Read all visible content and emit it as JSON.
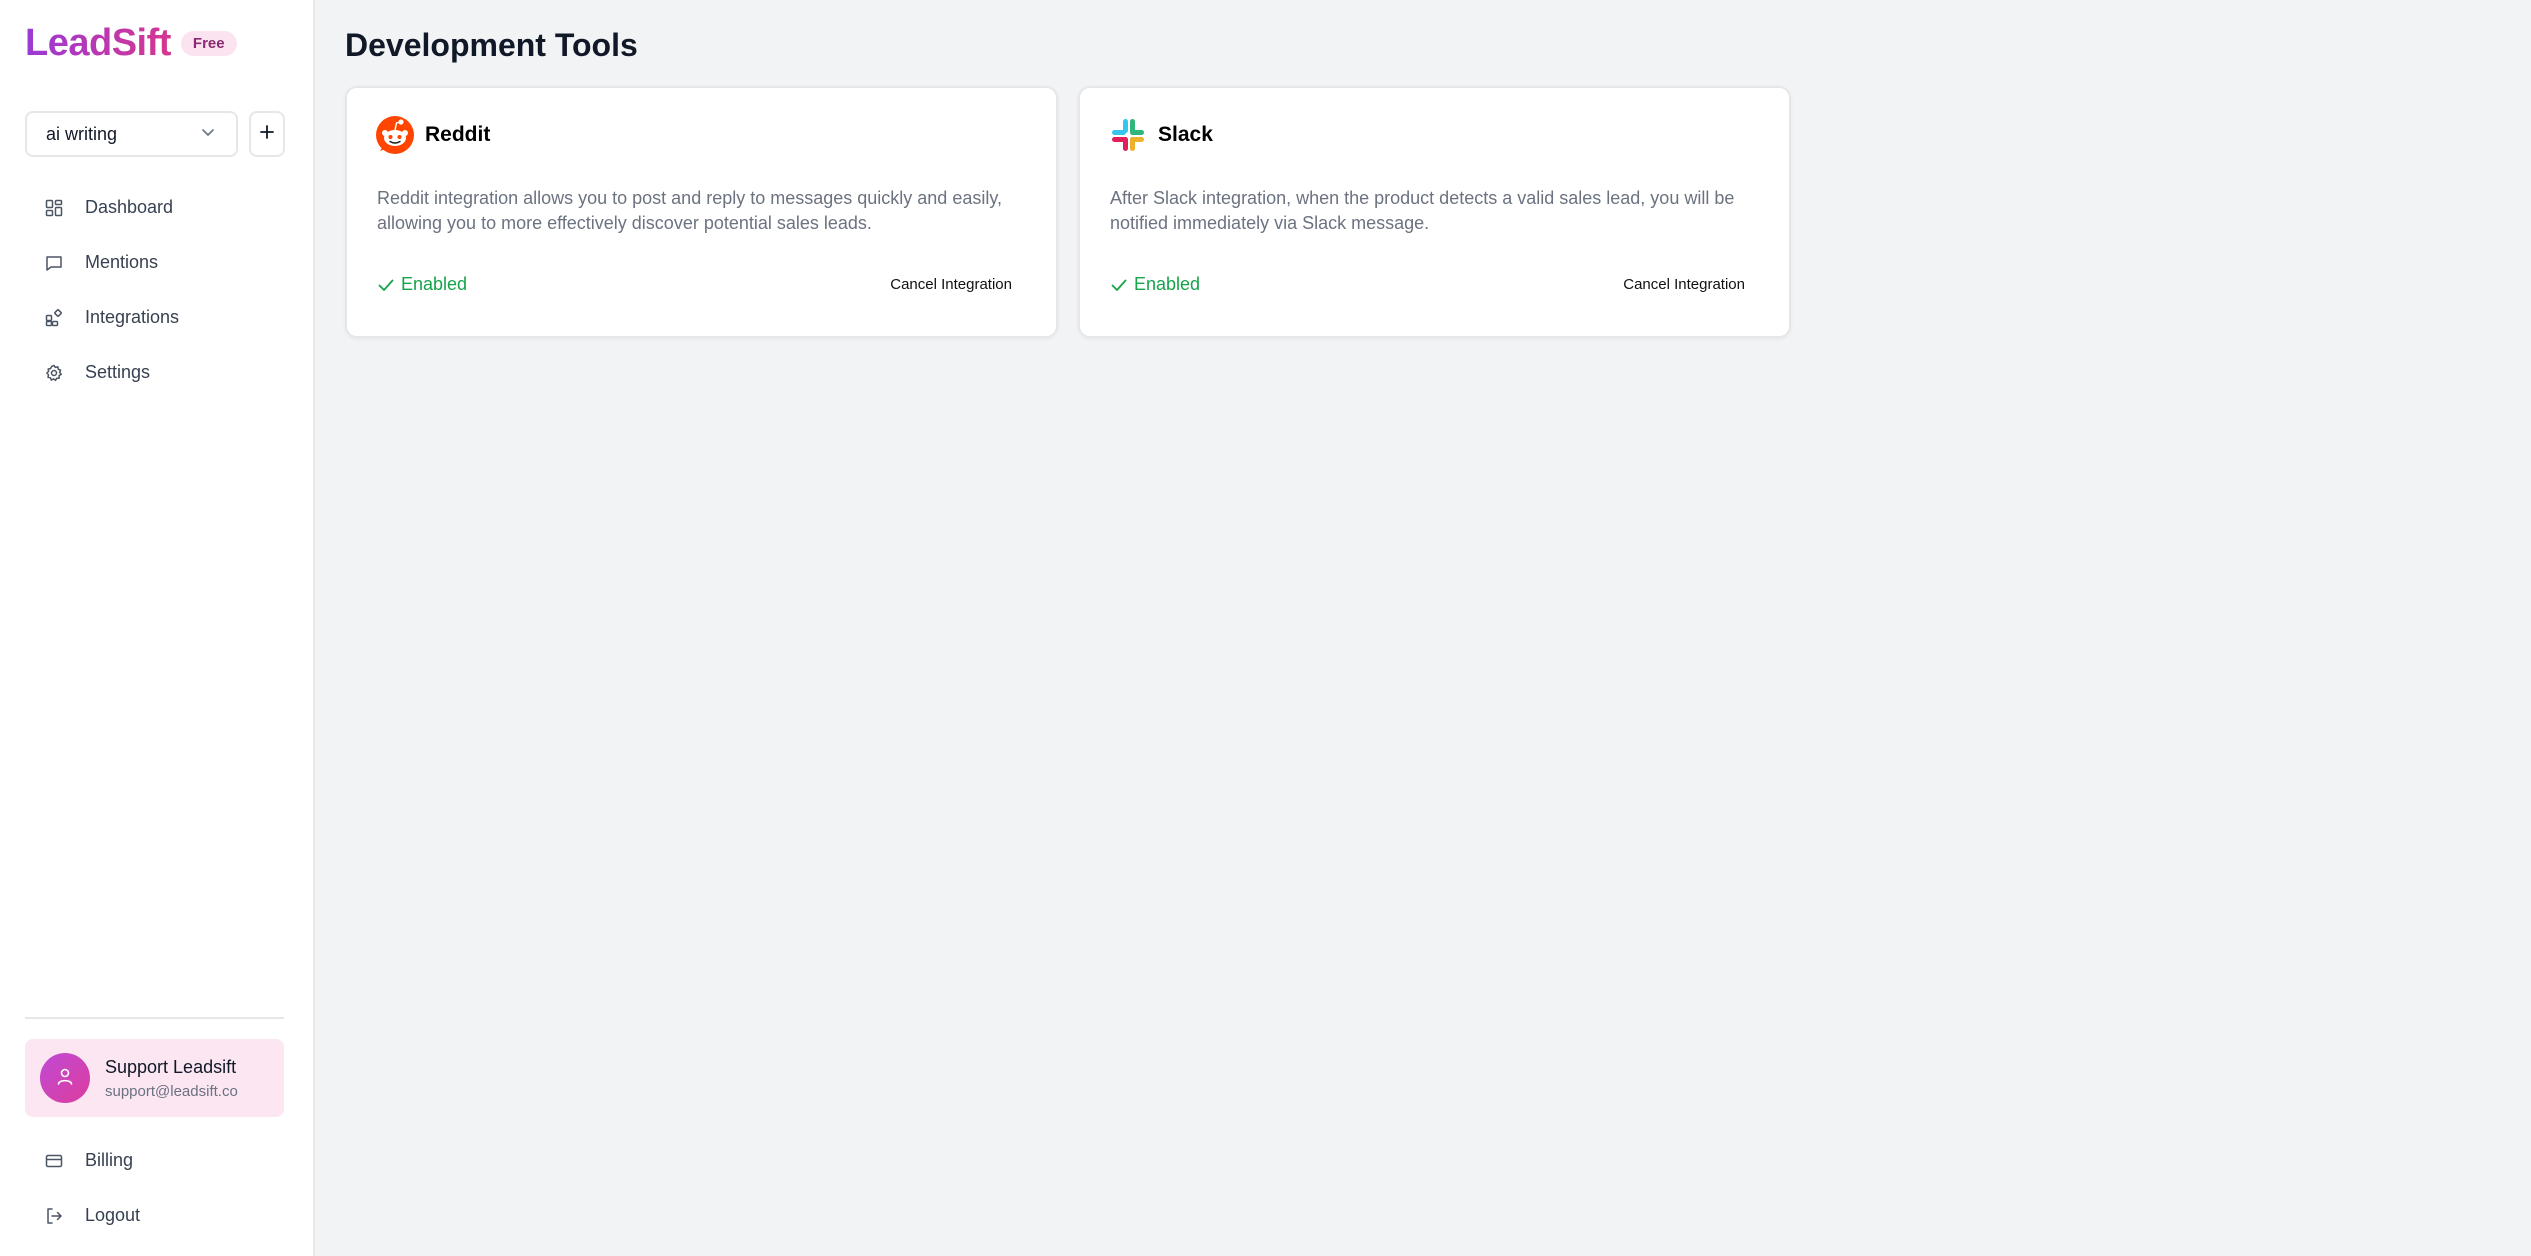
{
  "brand": {
    "name": "LeadSift",
    "plan": "Free"
  },
  "project": {
    "selected": "ai writing",
    "add_label": "+"
  },
  "nav": [
    {
      "label": "Dashboard",
      "icon": "dashboard-icon"
    },
    {
      "label": "Mentions",
      "icon": "message-icon"
    },
    {
      "label": "Integrations",
      "icon": "integrations-icon"
    },
    {
      "label": "Settings",
      "icon": "gear-icon"
    }
  ],
  "user": {
    "name": "Support Leadsift",
    "email": "support@leadsift.co",
    "icon": "user-icon"
  },
  "bottom_nav": [
    {
      "label": "Billing",
      "icon": "credit-card-icon"
    },
    {
      "label": "Logout",
      "icon": "logout-icon"
    }
  ],
  "main": {
    "title": "Development Tools",
    "cards": [
      {
        "title": "Reddit",
        "icon": "reddit-icon",
        "description": "Reddit integration allows you to post and reply to messages quickly and easily, allowing you to more effectively discover potential sales leads.",
        "status": "Enabled",
        "action": "Cancel Integration"
      },
      {
        "title": "Slack",
        "icon": "slack-icon",
        "description": "After Slack integration, when the product detects a valid sales lead, you will be notified immediately via Slack message.",
        "status": "Enabled",
        "action": "Cancel Integration"
      }
    ]
  },
  "colors": {
    "brand_gradient_start": "#9b3ad6",
    "brand_gradient_end": "#d6368f",
    "enabled": "#16a34a",
    "background": "#f2f3f5"
  }
}
